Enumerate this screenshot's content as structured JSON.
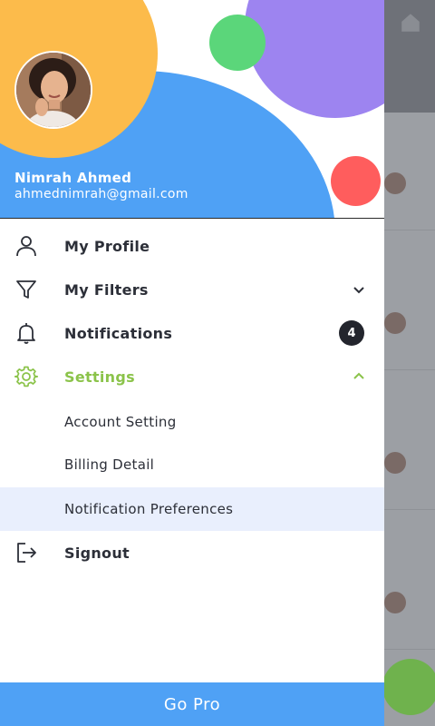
{
  "user": {
    "name": "Nimrah Ahmed",
    "email": "ahmednimrah@gmail.com",
    "avatar_icon": "user-avatar-photo"
  },
  "menu": {
    "profile": {
      "label": "My Profile",
      "icon": "user-icon"
    },
    "filters": {
      "label": "My Filters",
      "icon": "filter-icon",
      "expanded": false
    },
    "notifications": {
      "label": "Notifications",
      "icon": "bell-icon",
      "count": "4"
    },
    "settings": {
      "label": "Settings",
      "icon": "gear-icon",
      "expanded": true,
      "children": [
        {
          "label": "Account Setting"
        },
        {
          "label": "Billing Detail"
        },
        {
          "label": "Notification Preferences",
          "selected": true
        }
      ]
    },
    "signout": {
      "label": "Signout",
      "icon": "logout-icon"
    }
  },
  "footer": {
    "go_pro_label": "Go Pro"
  },
  "colors": {
    "accent_blue": "#4fa1f5",
    "accent_orange": "#fcbb4b",
    "accent_purple": "#9d84f0",
    "accent_green": "#5bd67a",
    "accent_red": "#ff5d5d",
    "active_green": "#8bc34a",
    "text_dark": "#2c2f38",
    "badge_bg": "#23252d",
    "selected_bg": "#e9effd"
  }
}
